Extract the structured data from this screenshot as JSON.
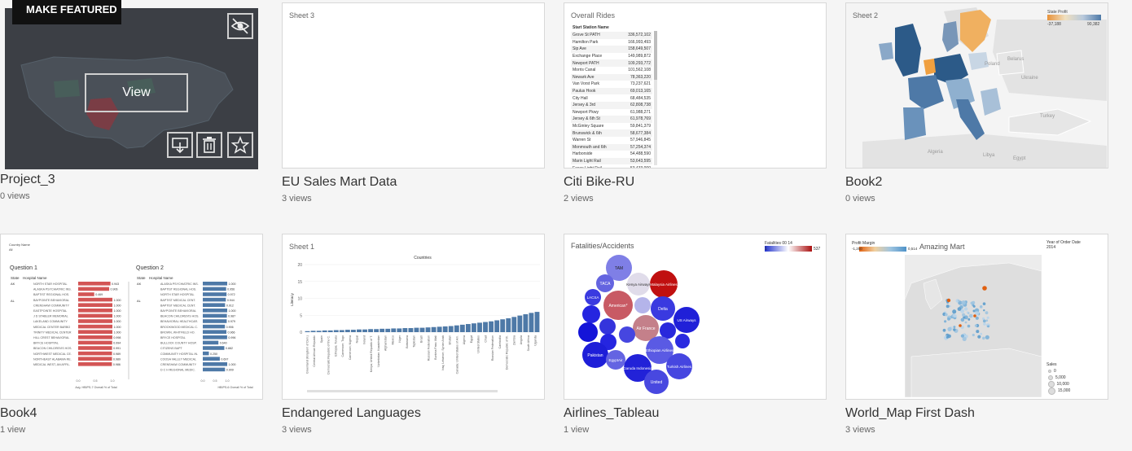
{
  "workbooks": [
    {
      "title": "Project_3",
      "views": "0 views"
    },
    {
      "title": "EU Sales Mart Data",
      "views": "3 views",
      "sheet": "Sheet 3"
    },
    {
      "title": "Citi Bike-RU",
      "views": "2 views",
      "sheet": "Overall Rides"
    },
    {
      "title": "Book2",
      "views": "0 views",
      "sheet": "Sheet 2"
    },
    {
      "title": "Book4",
      "views": "1 view"
    },
    {
      "title": "Endangered Languages",
      "views": "3 views",
      "sheet": "Sheet 1"
    },
    {
      "title": "Airlines_Tableau",
      "views": "1 view",
      "sheet": "Fatalities/Accidents"
    },
    {
      "title": "World_Map First Dash",
      "views": "3 views",
      "sheet": "Amazing Mart"
    }
  ],
  "hover": {
    "make_featured": "MAKE FEATURED",
    "view_label": "View"
  },
  "citi": {
    "header": "Start Station Name",
    "rows": [
      {
        "name": "Grove St PATH",
        "value": "336,572,102"
      },
      {
        "name": "Hamilton Park",
        "value": "166,993,493"
      },
      {
        "name": "Sip Ave",
        "value": "158,649,507"
      },
      {
        "name": "Exchange Place",
        "value": "149,989,872"
      },
      {
        "name": "Newport PATH",
        "value": "109,293,772"
      },
      {
        "name": "Morris Canal",
        "value": "101,562,108"
      },
      {
        "name": "Newark Ave",
        "value": "78,363,220"
      },
      {
        "name": "Van Vorst Park",
        "value": "73,237,621"
      },
      {
        "name": "Paulus Hook",
        "value": "69,013,165"
      },
      {
        "name": "City Hall",
        "value": "68,484,535"
      },
      {
        "name": "Jersey & 3rd",
        "value": "62,808,738"
      },
      {
        "name": "Newport Pkwy",
        "value": "61,988,271"
      },
      {
        "name": "Jersey & 6th St",
        "value": "61,978,769"
      },
      {
        "name": "McGinley Square",
        "value": "59,841,379"
      },
      {
        "name": "Brunswick & 6th",
        "value": "58,677,384"
      },
      {
        "name": "Warren St",
        "value": "57,946,845"
      },
      {
        "name": "Monmouth and 6th",
        "value": "57,254,374"
      },
      {
        "name": "Harborside",
        "value": "54,488,590"
      },
      {
        "name": "Marin Light Rail",
        "value": "53,643,595"
      },
      {
        "name": "Essex Light Rail",
        "value": "53,433,000"
      }
    ]
  },
  "book2": {
    "legend_title": "State Profit",
    "legend_min": "-37,188",
    "legend_max": "90,382",
    "labels": {
      "poland": "Poland",
      "belarus": "Belarus",
      "ukraine": "Ukraine",
      "turkey": "Turkey",
      "algeria": "Algeria",
      "libya": "Libya",
      "egypt": "Egypt"
    }
  },
  "book4": {
    "filter_label": "Country Name",
    "filter_value": "All",
    "q1": "Question 1",
    "q2": "Question 2",
    "state_col": "State",
    "hospital_col": "Hospital Name",
    "state_ak": "AK",
    "state_al": "AL",
    "hospitals": [
      "NORTH STAR HOSPITAL",
      "ALASKA PSYCHIATRIC INS.",
      "BAPTIST REGIONAL HOS.",
      "BAYPOINTE BEHAVIORAL",
      "CRENSHAW COMMUNITY",
      "EASTPOINTE HOSPITAL",
      "J D STABLER MEMORIAL",
      "LAKELAND COMMUNITY",
      "MEDICAL CENTER BARBO",
      "TRINITY MEDICAL CENTER",
      "HILL CREST BEHAVIORAL",
      "BRYCE HOSPITAL",
      "BEACON CHILDREN'S HOS.",
      "NORTHWEST MEDICAL CE.",
      "NORTHEAST ALABAMA RE.",
      "MEDICAL WEST, AN AFFIL."
    ],
    "q1_values": [
      0.943,
      0.906,
      0.469,
      1.0,
      1.0,
      1.0,
      1.0,
      1.0,
      1.0,
      1.0,
      0.998,
      0.994,
      0.991,
      0.989,
      0.989,
      0.986
    ],
    "q1_labels": [
      "0.943",
      "0.906",
      "0.469",
      "1.000",
      "1.000",
      "1.000",
      "1.000",
      "1.000",
      "1.000",
      "1.000",
      "0.998",
      "0.994",
      "0.991",
      "0.989",
      "0.989",
      "0.986"
    ],
    "hospitals_q2": [
      "ALASKA PSYCHIATRIC INS.",
      "BAPTIST REGIONAL HOS.",
      "NORTH STAR HOSPITAL",
      "BAPTIST MEDICAL CENT.",
      "BAPTIST MEDICAL CENT.",
      "BAYPOINTE BEHAVIORAL",
      "BEACON CHILDREN'S HOS.",
      "BEHAVIORAL HEALTHCAR.",
      "BROOKWOOD MEDICAL C.",
      "BROWN, WHITFIELD HO.",
      "BRYCE HOSPITAL",
      "BULLOCK COUNTY HOSP.",
      "CITIZENS BAPT",
      "COMMUNITY HOSPITAL IN.",
      "COOSA VALLEY MEDICAL",
      "CRENSHAW COMMUNITY",
      "D C H REGIONAL MEDIC."
    ],
    "q2_values": [
      1.0,
      0.956,
      0.972,
      0.944,
      0.912,
      1.0,
      0.987,
      0.979,
      0.906,
      0.966,
      0.996,
      0.64,
      0.882,
      0.25,
      0.697,
      1.0,
      0.909
    ],
    "q2_labels": [
      "1.000",
      "0.956",
      "0.972",
      "0.944",
      "0.912",
      "1.000",
      "0.987",
      "0.979",
      "0.906",
      "0.966",
      "0.996",
      "0.640",
      "0.882",
      "0.250",
      "0.697",
      "1.000",
      "0.909"
    ],
    "axis_ticks": [
      "0.0",
      "0.5",
      "1.0"
    ],
    "q1_axis_label": "Avg. HBIPS-7 Overall % of Total",
    "q2_axis_label": "HBIPS-6 Overall % of Total"
  },
  "chart_data": {
    "type": "bar",
    "title": "Countries",
    "ylabel": "Literacy",
    "ylim": [
      0,
      20
    ],
    "yticks": [
      0,
      5,
      10,
      15,
      20
    ],
    "values": [
      0.3,
      0.4,
      0.4,
      0.5,
      0.5,
      0.6,
      0.6,
      0.7,
      0.7,
      0.8,
      0.8,
      0.9,
      0.9,
      1.0,
      1.0,
      1.1,
      1.1,
      1.2,
      1.2,
      1.3,
      1.3,
      1.4,
      1.5,
      1.6,
      1.7,
      1.8,
      2.0,
      2.2,
      2.4,
      2.6,
      2.8,
      3.0,
      3.2,
      3.5,
      3.8,
      4.1,
      4.5,
      4.9,
      5.3,
      5.7,
      6.0
    ],
    "categories": [
      "Greenland (Kingdom of Den.)",
      "Central African Republic",
      "Spain",
      "Democratic Republic of the C.",
      "Ethiopia; Tuvalu",
      "Cameroon; Togo",
      "Cameroon; Nigeria",
      "Nepal",
      "Ireland",
      "Kenya; United Republic of T.",
      "Uzbekistan; Kazakhstan",
      "Afghanistan",
      "Mexico",
      "Niger",
      "Botswana",
      "Tajikistan",
      "Brazil",
      "Russian Federation",
      "Burkina Faso; Mali",
      "Iraq; Lebanon; Syrian Arab",
      "Bhutan",
      "Canada; United States of Am.",
      "Algeria",
      "Egypt",
      "United States",
      "Chad",
      "Russian Federation",
      "Cambodia",
      "Democratic Republic of th.",
      "Zambia",
      "Angola",
      "South Africa",
      "Uganda"
    ]
  },
  "airlines": {
    "legend_title": "Fatalities 00 14",
    "legend_min": "1",
    "legend_max": "537",
    "labels": {
      "tam": "TAM",
      "taca": "TACA",
      "kenya": "Kenya Airways",
      "malaysia": "Malaysia Airlines",
      "american": "American*",
      "lacsa": "LACSA",
      "delta": "Delta",
      "us_airways": "US Airways",
      "air_france": "Air France",
      "pakistan": "Pakistan",
      "egyptair": "EgyptAir",
      "ethiopian": "Ethiopian Airlines",
      "garuda": "Garuda Indonesia",
      "turkish": "Turkish Airlines",
      "united": "United"
    }
  },
  "worldmap": {
    "legend_title": "Profit Margin",
    "legend_min": "-1,250",
    "legend_max": "0,514",
    "year_label": "Year of Order Date",
    "year_value": "2014",
    "sales_title": "Sales",
    "sales_values": [
      "0",
      "5,000",
      "10,000",
      "15,000"
    ]
  },
  "colors": {
    "accent": "#4e79a7",
    "red": "#d35555",
    "dark_overlay": "#3c3f45"
  }
}
